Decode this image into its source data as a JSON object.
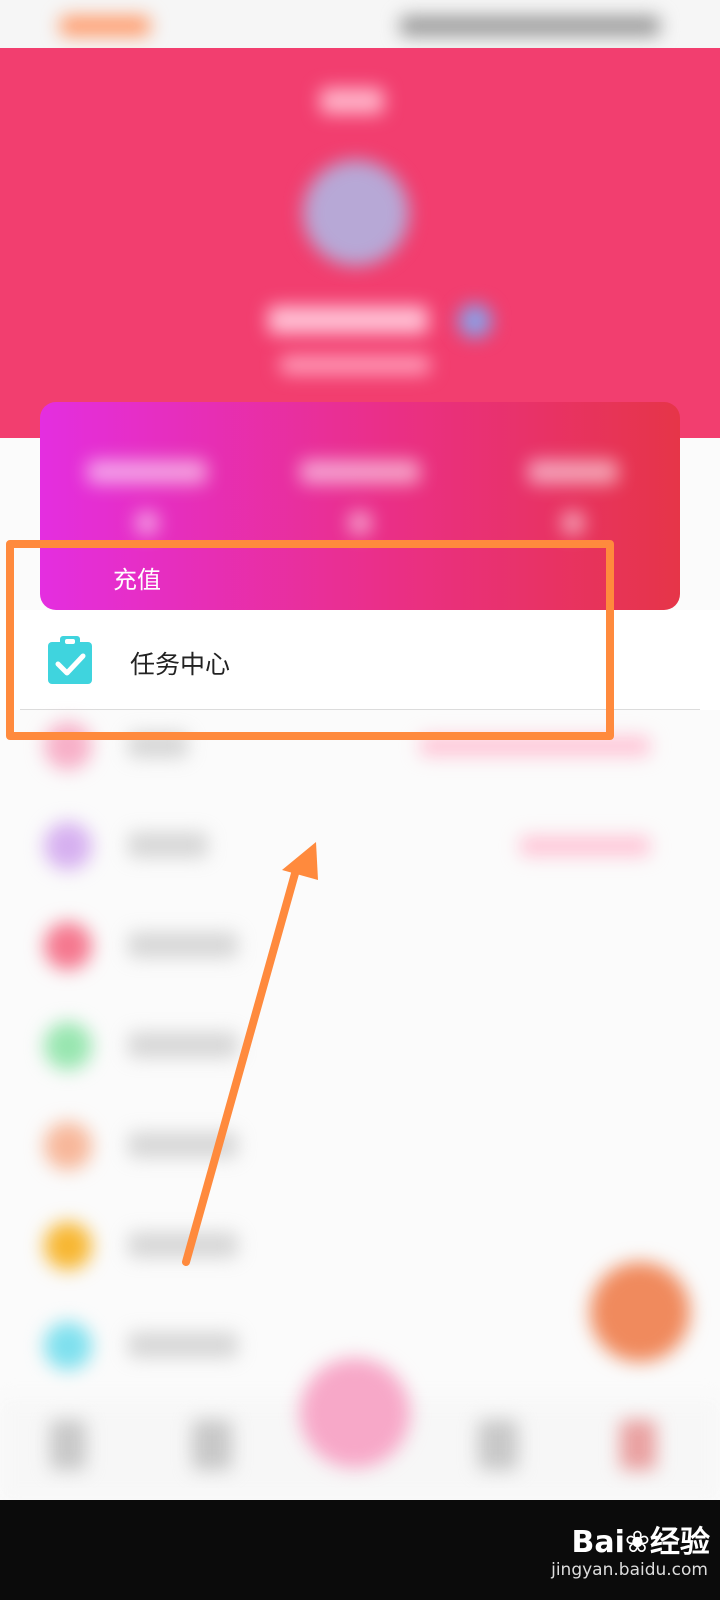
{
  "stats_card": {
    "recharge_label": "充值"
  },
  "task_center": {
    "label": "任务中心",
    "icon": "clipboard-check-icon",
    "icon_color": "#3fd4de"
  },
  "annotation": {
    "highlight_color": "#ff8a3d"
  },
  "watermark": {
    "brand": "Bai",
    "brand_suffix": "经验",
    "url": "jingyan.baidu.com"
  },
  "colors": {
    "header": "#f23e6f",
    "card_start": "#e42ee0",
    "card_end": "#e63548"
  }
}
